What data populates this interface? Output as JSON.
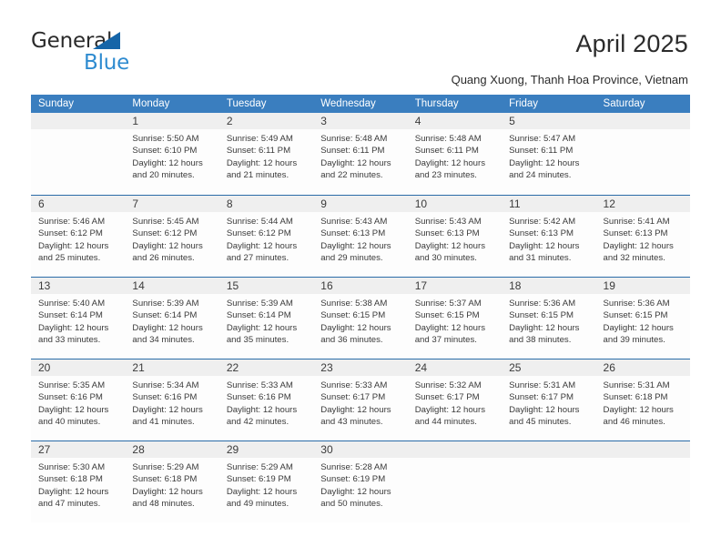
{
  "brand": {
    "name_part1": "General",
    "name_part2": "Blue",
    "accent_color": "#2e8bd0",
    "triangle_color": "#1565a8",
    "triangle_icon": "triangle-icon"
  },
  "header": {
    "title": "April 2025",
    "subtitle": "Quang Xuong, Thanh Hoa Province, Vietnam"
  },
  "calendar": {
    "header_background": "#3a7ebf",
    "header_text_color": "#ffffff",
    "row_divider_color": "#2a6ca8",
    "date_band_color": "#efefef",
    "weekdays": [
      "Sunday",
      "Monday",
      "Tuesday",
      "Wednesday",
      "Thursday",
      "Friday",
      "Saturday"
    ],
    "weeks": [
      [
        {
          "day": "",
          "empty": true,
          "sunrise": "",
          "sunset": "",
          "daylight_line1": "",
          "daylight_line2": ""
        },
        {
          "day": "1",
          "empty": false,
          "sunrise": "Sunrise: 5:50 AM",
          "sunset": "Sunset: 6:10 PM",
          "daylight_line1": "Daylight: 12 hours",
          "daylight_line2": "and 20 minutes."
        },
        {
          "day": "2",
          "empty": false,
          "sunrise": "Sunrise: 5:49 AM",
          "sunset": "Sunset: 6:11 PM",
          "daylight_line1": "Daylight: 12 hours",
          "daylight_line2": "and 21 minutes."
        },
        {
          "day": "3",
          "empty": false,
          "sunrise": "Sunrise: 5:48 AM",
          "sunset": "Sunset: 6:11 PM",
          "daylight_line1": "Daylight: 12 hours",
          "daylight_line2": "and 22 minutes."
        },
        {
          "day": "4",
          "empty": false,
          "sunrise": "Sunrise: 5:48 AM",
          "sunset": "Sunset: 6:11 PM",
          "daylight_line1": "Daylight: 12 hours",
          "daylight_line2": "and 23 minutes."
        },
        {
          "day": "5",
          "empty": false,
          "sunrise": "Sunrise: 5:47 AM",
          "sunset": "Sunset: 6:11 PM",
          "daylight_line1": "Daylight: 12 hours",
          "daylight_line2": "and 24 minutes."
        },
        {
          "day": "",
          "empty": true,
          "sunrise": "",
          "sunset": "",
          "daylight_line1": "",
          "daylight_line2": ""
        }
      ],
      [
        {
          "day": "6",
          "empty": false,
          "sunrise": "Sunrise: 5:46 AM",
          "sunset": "Sunset: 6:12 PM",
          "daylight_line1": "Daylight: 12 hours",
          "daylight_line2": "and 25 minutes."
        },
        {
          "day": "7",
          "empty": false,
          "sunrise": "Sunrise: 5:45 AM",
          "sunset": "Sunset: 6:12 PM",
          "daylight_line1": "Daylight: 12 hours",
          "daylight_line2": "and 26 minutes."
        },
        {
          "day": "8",
          "empty": false,
          "sunrise": "Sunrise: 5:44 AM",
          "sunset": "Sunset: 6:12 PM",
          "daylight_line1": "Daylight: 12 hours",
          "daylight_line2": "and 27 minutes."
        },
        {
          "day": "9",
          "empty": false,
          "sunrise": "Sunrise: 5:43 AM",
          "sunset": "Sunset: 6:13 PM",
          "daylight_line1": "Daylight: 12 hours",
          "daylight_line2": "and 29 minutes."
        },
        {
          "day": "10",
          "empty": false,
          "sunrise": "Sunrise: 5:43 AM",
          "sunset": "Sunset: 6:13 PM",
          "daylight_line1": "Daylight: 12 hours",
          "daylight_line2": "and 30 minutes."
        },
        {
          "day": "11",
          "empty": false,
          "sunrise": "Sunrise: 5:42 AM",
          "sunset": "Sunset: 6:13 PM",
          "daylight_line1": "Daylight: 12 hours",
          "daylight_line2": "and 31 minutes."
        },
        {
          "day": "12",
          "empty": false,
          "sunrise": "Sunrise: 5:41 AM",
          "sunset": "Sunset: 6:13 PM",
          "daylight_line1": "Daylight: 12 hours",
          "daylight_line2": "and 32 minutes."
        }
      ],
      [
        {
          "day": "13",
          "empty": false,
          "sunrise": "Sunrise: 5:40 AM",
          "sunset": "Sunset: 6:14 PM",
          "daylight_line1": "Daylight: 12 hours",
          "daylight_line2": "and 33 minutes."
        },
        {
          "day": "14",
          "empty": false,
          "sunrise": "Sunrise: 5:39 AM",
          "sunset": "Sunset: 6:14 PM",
          "daylight_line1": "Daylight: 12 hours",
          "daylight_line2": "and 34 minutes."
        },
        {
          "day": "15",
          "empty": false,
          "sunrise": "Sunrise: 5:39 AM",
          "sunset": "Sunset: 6:14 PM",
          "daylight_line1": "Daylight: 12 hours",
          "daylight_line2": "and 35 minutes."
        },
        {
          "day": "16",
          "empty": false,
          "sunrise": "Sunrise: 5:38 AM",
          "sunset": "Sunset: 6:15 PM",
          "daylight_line1": "Daylight: 12 hours",
          "daylight_line2": "and 36 minutes."
        },
        {
          "day": "17",
          "empty": false,
          "sunrise": "Sunrise: 5:37 AM",
          "sunset": "Sunset: 6:15 PM",
          "daylight_line1": "Daylight: 12 hours",
          "daylight_line2": "and 37 minutes."
        },
        {
          "day": "18",
          "empty": false,
          "sunrise": "Sunrise: 5:36 AM",
          "sunset": "Sunset: 6:15 PM",
          "daylight_line1": "Daylight: 12 hours",
          "daylight_line2": "and 38 minutes."
        },
        {
          "day": "19",
          "empty": false,
          "sunrise": "Sunrise: 5:36 AM",
          "sunset": "Sunset: 6:15 PM",
          "daylight_line1": "Daylight: 12 hours",
          "daylight_line2": "and 39 minutes."
        }
      ],
      [
        {
          "day": "20",
          "empty": false,
          "sunrise": "Sunrise: 5:35 AM",
          "sunset": "Sunset: 6:16 PM",
          "daylight_line1": "Daylight: 12 hours",
          "daylight_line2": "and 40 minutes."
        },
        {
          "day": "21",
          "empty": false,
          "sunrise": "Sunrise: 5:34 AM",
          "sunset": "Sunset: 6:16 PM",
          "daylight_line1": "Daylight: 12 hours",
          "daylight_line2": "and 41 minutes."
        },
        {
          "day": "22",
          "empty": false,
          "sunrise": "Sunrise: 5:33 AM",
          "sunset": "Sunset: 6:16 PM",
          "daylight_line1": "Daylight: 12 hours",
          "daylight_line2": "and 42 minutes."
        },
        {
          "day": "23",
          "empty": false,
          "sunrise": "Sunrise: 5:33 AM",
          "sunset": "Sunset: 6:17 PM",
          "daylight_line1": "Daylight: 12 hours",
          "daylight_line2": "and 43 minutes."
        },
        {
          "day": "24",
          "empty": false,
          "sunrise": "Sunrise: 5:32 AM",
          "sunset": "Sunset: 6:17 PM",
          "daylight_line1": "Daylight: 12 hours",
          "daylight_line2": "and 44 minutes."
        },
        {
          "day": "25",
          "empty": false,
          "sunrise": "Sunrise: 5:31 AM",
          "sunset": "Sunset: 6:17 PM",
          "daylight_line1": "Daylight: 12 hours",
          "daylight_line2": "and 45 minutes."
        },
        {
          "day": "26",
          "empty": false,
          "sunrise": "Sunrise: 5:31 AM",
          "sunset": "Sunset: 6:18 PM",
          "daylight_line1": "Daylight: 12 hours",
          "daylight_line2": "and 46 minutes."
        }
      ],
      [
        {
          "day": "27",
          "empty": false,
          "sunrise": "Sunrise: 5:30 AM",
          "sunset": "Sunset: 6:18 PM",
          "daylight_line1": "Daylight: 12 hours",
          "daylight_line2": "and 47 minutes."
        },
        {
          "day": "28",
          "empty": false,
          "sunrise": "Sunrise: 5:29 AM",
          "sunset": "Sunset: 6:18 PM",
          "daylight_line1": "Daylight: 12 hours",
          "daylight_line2": "and 48 minutes."
        },
        {
          "day": "29",
          "empty": false,
          "sunrise": "Sunrise: 5:29 AM",
          "sunset": "Sunset: 6:19 PM",
          "daylight_line1": "Daylight: 12 hours",
          "daylight_line2": "and 49 minutes."
        },
        {
          "day": "30",
          "empty": false,
          "sunrise": "Sunrise: 5:28 AM",
          "sunset": "Sunset: 6:19 PM",
          "daylight_line1": "Daylight: 12 hours",
          "daylight_line2": "and 50 minutes."
        },
        {
          "day": "",
          "empty": true,
          "sunrise": "",
          "sunset": "",
          "daylight_line1": "",
          "daylight_line2": ""
        },
        {
          "day": "",
          "empty": true,
          "sunrise": "",
          "sunset": "",
          "daylight_line1": "",
          "daylight_line2": ""
        },
        {
          "day": "",
          "empty": true,
          "sunrise": "",
          "sunset": "",
          "daylight_line1": "",
          "daylight_line2": ""
        }
      ]
    ]
  }
}
